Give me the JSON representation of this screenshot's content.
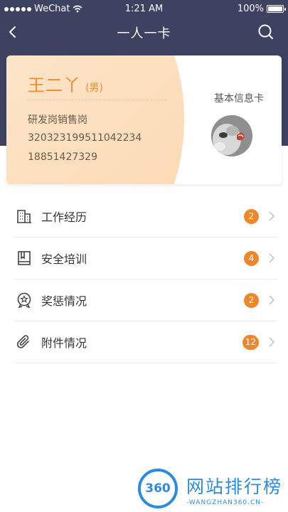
{
  "status_bar": {
    "carrier": "WeChat",
    "time": "1:21 AM",
    "battery": "100%"
  },
  "nav": {
    "title": "一人一卡",
    "back_icon": "chevron-left-icon",
    "search_icon": "search-icon"
  },
  "profile_card": {
    "name": "王二丫",
    "gender": "(男)",
    "department": "研发岗销售岗",
    "id_number": "320323199511042234",
    "phone": "18851427329",
    "card_title": "基本信息卡",
    "avatar": "cat-avatar"
  },
  "menu": [
    {
      "label": "工作经历",
      "count": "2",
      "icon": "building-icon"
    },
    {
      "label": "安全培训",
      "count": "4",
      "icon": "book-icon"
    },
    {
      "label": "奖惩情况",
      "count": "2",
      "icon": "badge-icon"
    },
    {
      "label": "附件情况",
      "count": "12",
      "icon": "paperclip-icon"
    }
  ],
  "watermark": {
    "number": "360",
    "title": "网站排行榜",
    "subtitle": "-WANGZHAN360.CN-"
  },
  "colors": {
    "header": "#3d4260",
    "accent": "#f08d2b",
    "badge": "#f0862a",
    "peach": "#fde8cf"
  }
}
